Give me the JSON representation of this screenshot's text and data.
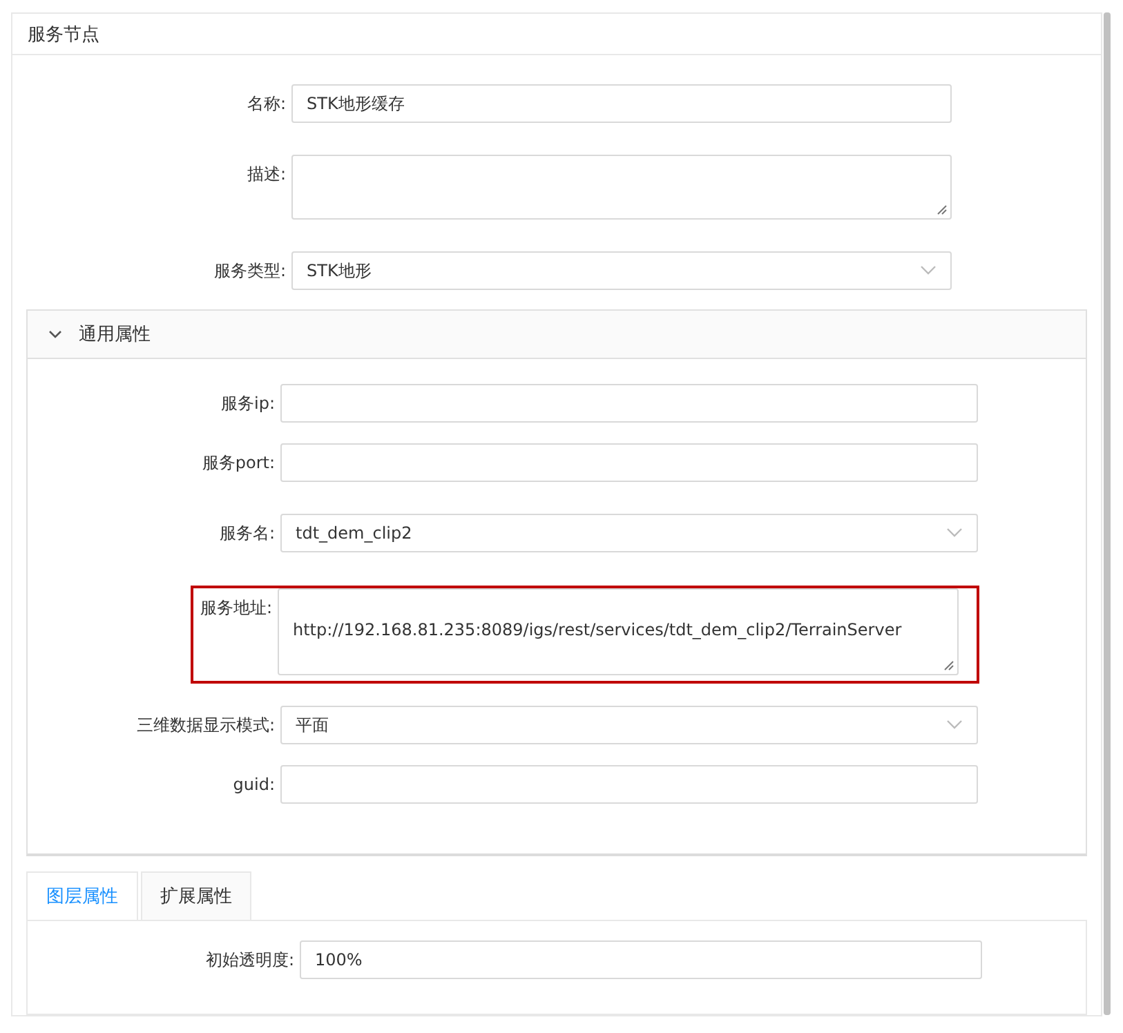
{
  "card": {
    "title": "服务节点"
  },
  "fields": [
    {
      "label": "名称:",
      "kind": "text",
      "value": "STK地形缓存"
    },
    {
      "label": "描述:",
      "kind": "textarea"
    },
    {
      "label": "服务类型:",
      "kind": "select",
      "value": "STK地形"
    }
  ],
  "general_panel": {
    "title": "通用属性",
    "expanded": true,
    "fields": [
      {
        "label": "服务ip:",
        "kind": "text",
        "highlighted": false
      },
      {
        "label": "服务port:",
        "kind": "text",
        "highlighted": false
      },
      {
        "label": "服务名:",
        "kind": "select",
        "value": "tdt_dem_clip2",
        "highlighted": false
      },
      {
        "label": "服务地址:",
        "kind": "textarea",
        "value": "http://192.168.81.235:8089/igs/rest/services/tdt_dem_clip2/TerrainServer",
        "highlighted": true
      },
      {
        "label": "三维数据显示模式:",
        "kind": "select",
        "value": "平面",
        "highlighted": false
      },
      {
        "label": "guid:",
        "kind": "text",
        "highlighted": false
      }
    ]
  },
  "tabs": [
    {
      "label": "图层属性",
      "selected": true
    },
    {
      "label": "扩展属性",
      "selected": false
    }
  ],
  "tab_fields": [
    {
      "label": "初始透明度:",
      "kind": "text",
      "value": "100%"
    }
  ]
}
